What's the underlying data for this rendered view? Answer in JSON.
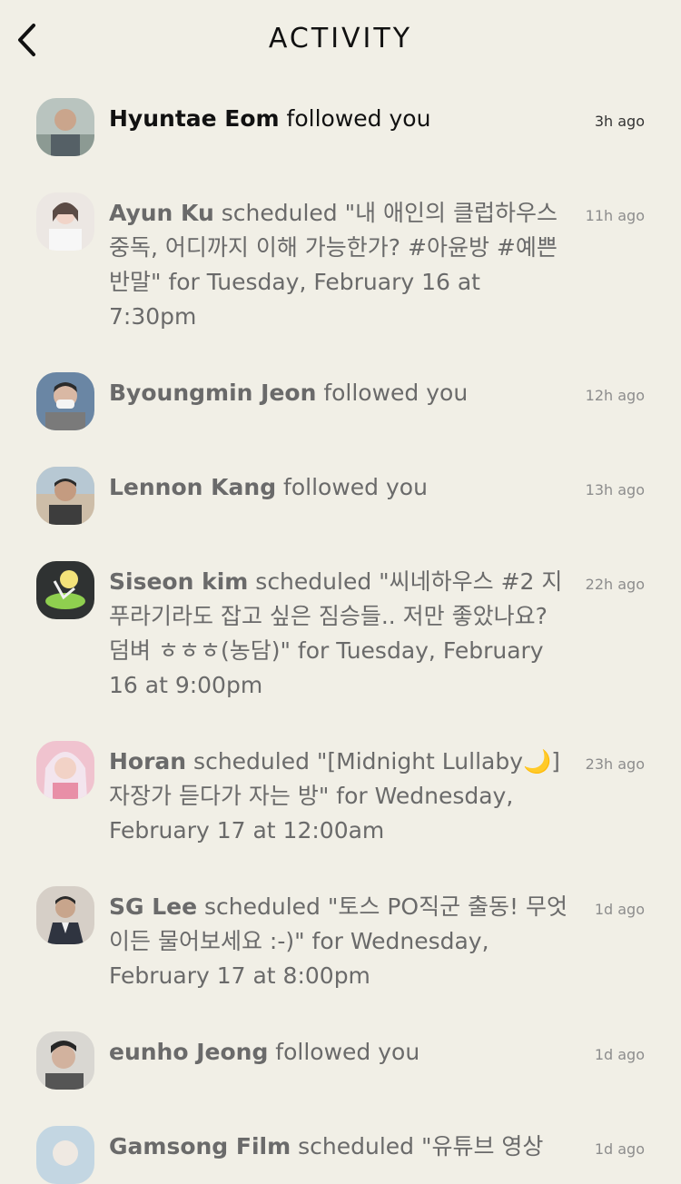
{
  "header": {
    "title": "ACTIVITY",
    "back_icon": "chevron-left-icon"
  },
  "activities": [
    {
      "name": "Hyuntae Eom",
      "action": " followed you",
      "time": "3h ago",
      "avatar_color": "#9aa7a0"
    },
    {
      "name": "Ayun Ku",
      "action": " scheduled \"내 애인의 클럽하우스 중독, 어디까지 이해 가능한가? #아윤방 #예쁜반말\" for Tuesday, February 16 at 7:30pm",
      "time": "11h ago",
      "avatar_color": "#e9e3df"
    },
    {
      "name": "Byoungmin Jeon",
      "action": " followed you",
      "time": "12h ago",
      "avatar_color": "#6f7d8c"
    },
    {
      "name": "Lennon Kang",
      "action": " followed you",
      "time": "13h ago",
      "avatar_color": "#c9b9a3"
    },
    {
      "name": "Siseon kim",
      "action": " scheduled \"씨네하우스 #2 지푸라기라도 잡고 싶은 짐승들.. 저만 좋았나요? 덤벼 ㅎㅎㅎ(농담)\" for Tuesday, February 16 at 9:00pm",
      "time": "22h ago",
      "avatar_color": "#2f3232"
    },
    {
      "name": "Horan",
      "action": " scheduled \"[Midnight Lullaby🌙] 자장가 듣다가 자는 방\" for Wednesday, February 17 at 12:00am",
      "time": "23h ago",
      "avatar_color": "#e7a8b7"
    },
    {
      "name": "SG Lee",
      "action": " scheduled \"토스 PO직군 출동! 무엇이든 물어보세요 :-)\" for Wednesday, February 17 at 8:00pm",
      "time": "1d ago",
      "avatar_color": "#a08b7b"
    },
    {
      "name": "eunho Jeong",
      "action": " followed you",
      "time": "1d ago",
      "avatar_color": "#7b7f83"
    },
    {
      "name": "Gamsong Film",
      "action": " scheduled \"유튜브 영상",
      "time": "1d ago",
      "avatar_color": "#c3d6e2"
    }
  ]
}
